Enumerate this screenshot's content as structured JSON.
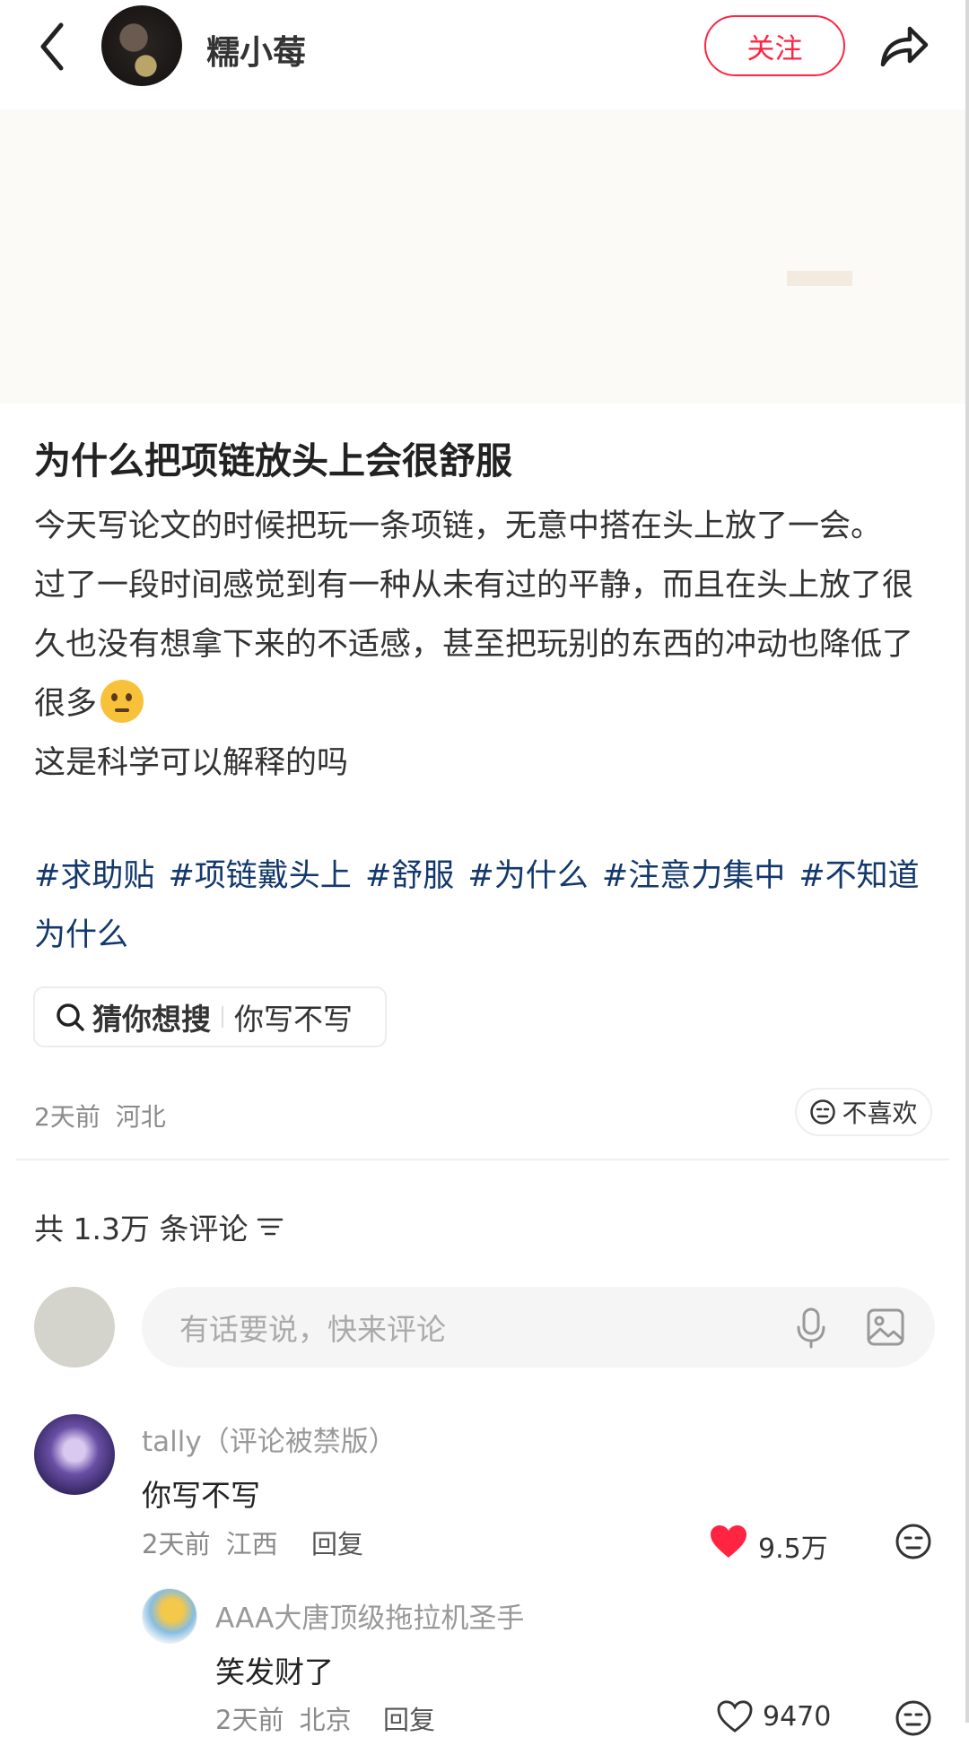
{
  "header": {
    "author_name": "糯小莓",
    "follow_label": "关注"
  },
  "post": {
    "title": "为什么把项链放头上会很舒服",
    "paragraphs": [
      "今天写论文的时候把玩一条项链，无意中搭在头上放了一会。",
      "过了一段时间感觉到有一种从未有过的平静，而且在头上放了很久也没有想拿下来的不适感，甚至把玩别的东西的冲动也降低了很多",
      "这是科学可以解释的吗"
    ],
    "tags": [
      "#求助贴",
      "#项链戴头上",
      "#舒服",
      "#为什么",
      "#注意力集中",
      "#不知道为什么"
    ],
    "search_chip": {
      "label": "猜你想搜",
      "query": "你写不写"
    },
    "time": "2天前",
    "location": "河北",
    "dislike_label": "不喜欢"
  },
  "comments_section": {
    "count_label": "共 1.3万 条评论",
    "input_placeholder": "有话要说，快来评论",
    "comments": [
      {
        "name": "tally（评论被禁版）",
        "text": "你写不写",
        "time": "2天前",
        "location": "江西",
        "reply_label": "回复",
        "likes": "9.5万",
        "liked": true
      },
      {
        "name": "AAA大唐顶级拖拉机圣手",
        "text": "笑发财了",
        "time": "2天前",
        "location": "北京",
        "reply_label": "回复",
        "likes": "9470",
        "liked": false
      }
    ]
  },
  "colors": {
    "accent": "#ff2442",
    "tag": "#13386c",
    "muted": "#8a8a8a"
  },
  "icons": [
    "back-icon",
    "share-icon",
    "search-icon",
    "dislike-face-icon",
    "filter-icon",
    "mic-icon",
    "image-icon",
    "heart-icon",
    "face-icon"
  ]
}
